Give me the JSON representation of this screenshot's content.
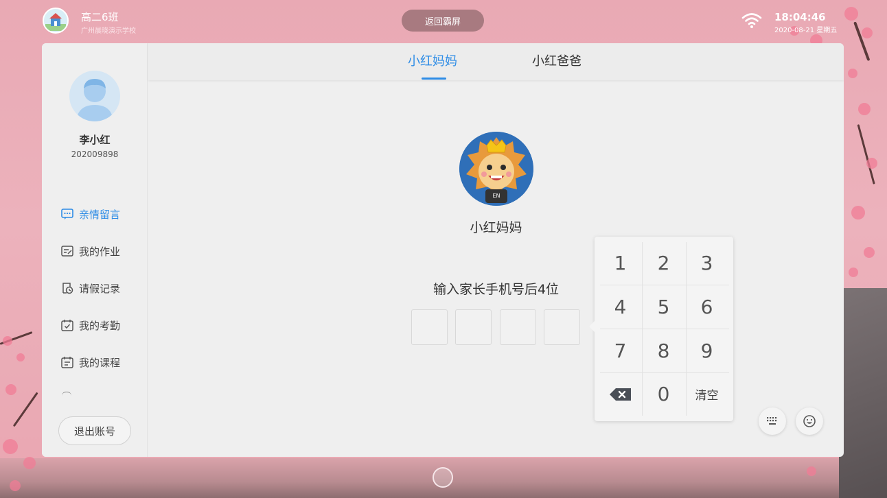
{
  "header": {
    "class_name": "高二6班",
    "school_name": "广州晨晓演示学校",
    "back_button": "返回霸屏",
    "time": "18:04:46",
    "date": "2020-08-21 星期五"
  },
  "student": {
    "name": "李小红",
    "id": "202009898"
  },
  "sidebar": {
    "items": [
      {
        "label": "亲情留言",
        "icon": "message-icon",
        "active": true
      },
      {
        "label": "我的作业",
        "icon": "homework-icon",
        "active": false
      },
      {
        "label": "请假记录",
        "icon": "leave-record-icon",
        "active": false
      },
      {
        "label": "我的考勤",
        "icon": "attendance-icon",
        "active": false
      },
      {
        "label": "我的课程",
        "icon": "course-icon",
        "active": false
      }
    ],
    "logout_label": "退出账号"
  },
  "tabs": [
    {
      "label": "小红妈妈",
      "active": true
    },
    {
      "label": "小红爸爸",
      "active": false
    }
  ],
  "parent": {
    "name": "小红妈妈",
    "badge_text": "EN"
  },
  "pin": {
    "prompt": "输入家长手机号后4位",
    "digits": [
      "",
      "",
      "",
      ""
    ]
  },
  "keypad": {
    "keys": [
      "1",
      "2",
      "3",
      "4",
      "5",
      "6",
      "7",
      "8",
      "9",
      "backspace",
      "0",
      "清空"
    ]
  },
  "colors": {
    "accent": "#2d8ce6",
    "background": "#ecb2bc",
    "panel": "#efefef"
  }
}
